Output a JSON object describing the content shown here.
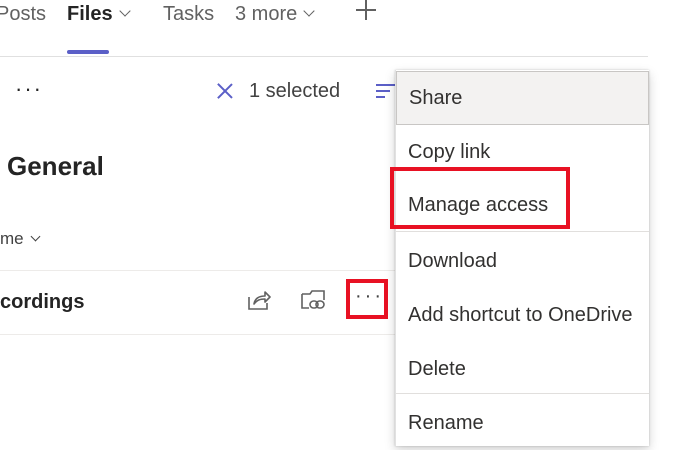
{
  "tabs": [
    {
      "label": "Posts"
    },
    {
      "label": "Files"
    },
    {
      "label": "Tasks"
    },
    {
      "label": "3 more"
    }
  ],
  "command_bar": {
    "more_label": "···",
    "selection_count_label": "1 selected"
  },
  "page": {
    "title": "General",
    "column_header": "me"
  },
  "row": {
    "name": "cordings",
    "more_label": "···"
  },
  "context_menu": {
    "items": [
      {
        "label": "Share"
      },
      {
        "label": "Copy link"
      },
      {
        "label": "Manage access"
      },
      {
        "label": "Download"
      },
      {
        "label": "Add shortcut to OneDrive"
      },
      {
        "label": "Delete"
      },
      {
        "label": "Rename"
      }
    ]
  },
  "colors": {
    "accent": "#5b5fc7",
    "highlight": "#e81123"
  }
}
